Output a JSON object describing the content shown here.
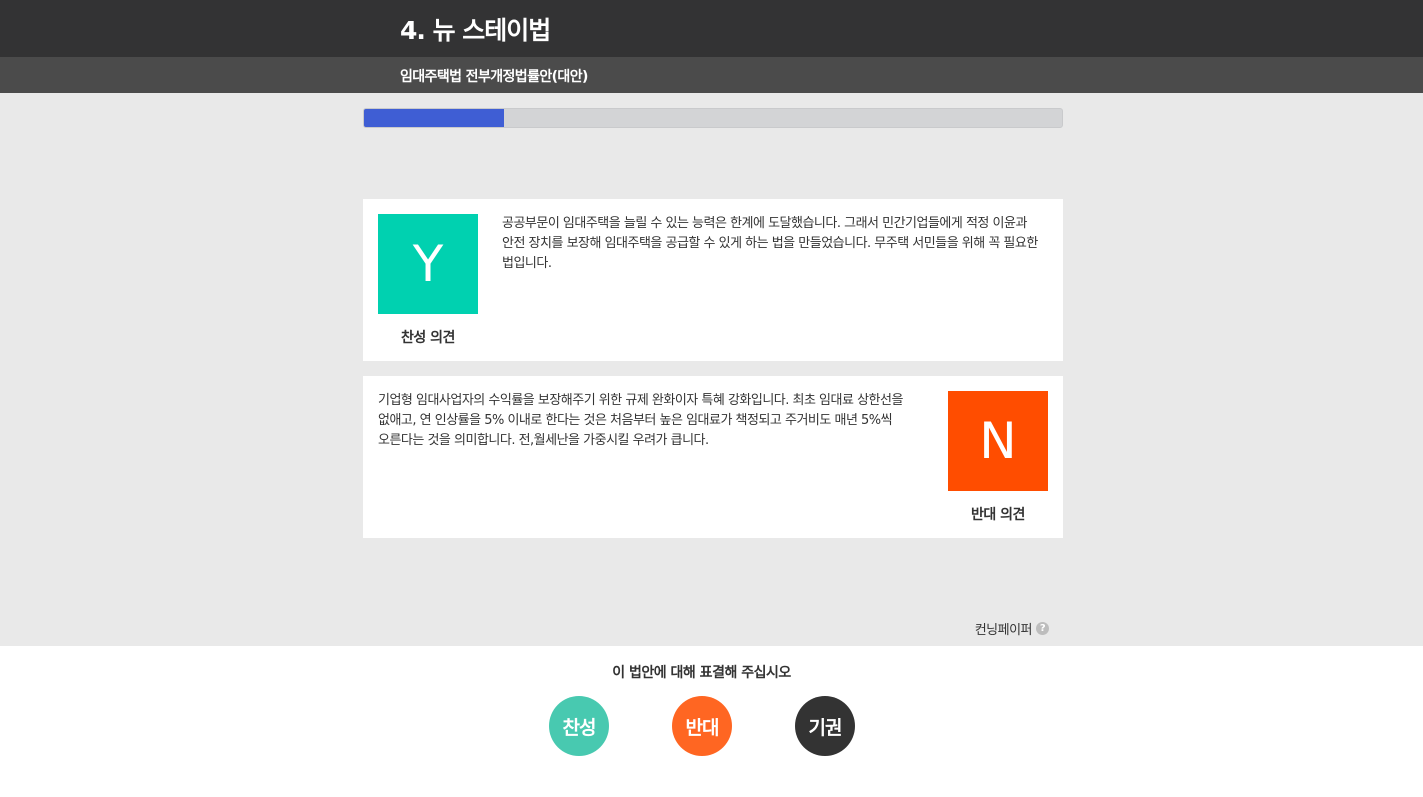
{
  "header": {
    "title": "4. 뉴 스테이법",
    "subtitle": "임대주택법 전부개정법률안(대안)"
  },
  "progress": {
    "fraction": 0.2
  },
  "pro_opinion": {
    "letter": "Y",
    "caption": "찬성 의견",
    "text": "공공부문이 임대주택을 늘릴 수 있는 능력은 한계에 도달했습니다. 그래서 민간기업들에게 적정 이윤과 안전 장치를 보장해 임대주택을 공급할 수 있게 하는 법을 만들었습니다. 무주택 서민들을 위해 꼭 필요한 법입니다.",
    "color": "#00d1b0"
  },
  "con_opinion": {
    "letter": "N",
    "caption": "반대 의견",
    "text": "기업형 임대사업자의 수익률을 보장해주기 위한 규제 완화이자 특혜 강화입니다. 최초 임대료 상한선을 없애고, 연 인상률을 5% 이내로 한다는 것은 처음부터 높은 임대료가 책정되고 주거비도 매년 5%씩 오른다는 것을 의미합니다. 전,월세난을 가중시킬 우려가 큽니다.",
    "color": "#ff4d00"
  },
  "cheat_sheet": {
    "label": "컨닝페이퍼",
    "icon": "question-circle-icon",
    "icon_glyph": "?"
  },
  "vote": {
    "prompt": "이 법안에 대해 표결해 주십시오",
    "yes_label": "찬성",
    "no_label": "반대",
    "abstain_label": "기권",
    "colors": {
      "yes": "#48c9b0",
      "no": "#ff6622",
      "abstain": "#333333"
    }
  }
}
